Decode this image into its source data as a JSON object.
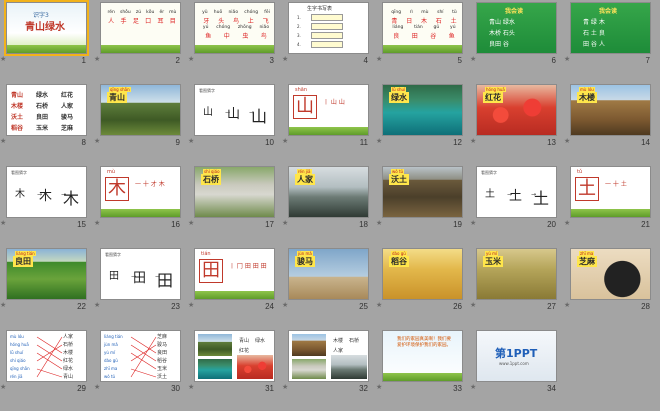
{
  "window": {
    "title": "Slide Sorter"
  },
  "slides": [
    {
      "n": "1",
      "kind": "title",
      "tag": "识字3",
      "title": "青山绿水",
      "foot": "第一PPT模板网-WWW.1PPT.COM"
    },
    {
      "n": "2",
      "kind": "pinyin",
      "rows": [
        [
          "rén",
          "shǒu",
          "zú",
          "kǒu",
          "ěr",
          "mù"
        ],
        [
          "人",
          "手",
          "足",
          "口",
          "耳",
          "目"
        ]
      ]
    },
    {
      "n": "3",
      "kind": "pinyin",
      "rows": [
        [
          "yǔ",
          "huō",
          "niǎo",
          "chóng",
          "fēi"
        ],
        [
          "牙",
          "头",
          "鸟",
          "上",
          "飞"
        ],
        [
          "yú",
          "chóng",
          "zhōng",
          "niǎo"
        ],
        [
          "鱼",
          "中",
          "虫",
          "鸟"
        ]
      ]
    },
    {
      "n": "4",
      "kind": "table",
      "title": "生字书写表",
      "rows": [
        "1.",
        "2.",
        "3.",
        "4."
      ]
    },
    {
      "n": "5",
      "kind": "pinyin",
      "rows": [
        [
          "qīng",
          "rì",
          "mù",
          "shí",
          "tǔ"
        ],
        [
          "青",
          "日",
          "木",
          "石",
          "土"
        ],
        [
          "liáng",
          "tián",
          "gǔ",
          "yú"
        ],
        [
          "良",
          "田",
          "谷",
          "鱼"
        ]
      ]
    },
    {
      "n": "6",
      "kind": "green",
      "head": "我会读",
      "lines": [
        "青山 绿水",
        "木桥 石头",
        "良田 谷"
      ]
    },
    {
      "n": "7",
      "kind": "green",
      "head": "我会读",
      "lines": [
        "青 绿 木",
        "石 土 良",
        "田 谷 人"
      ]
    },
    {
      "n": "8",
      "kind": "words",
      "cols": [
        "青山",
        "绿水",
        "红花"
      ],
      "rows": [
        [
          "青山",
          "绿水",
          "红花"
        ],
        [
          "木楼",
          "石桥",
          "人家"
        ],
        [
          "沃土",
          "良田",
          "骏马"
        ],
        [
          "稻谷",
          "玉米",
          "芝麻"
        ]
      ]
    },
    {
      "n": "9",
      "kind": "photo",
      "label": "青山",
      "pin": "qīng shān",
      "scene": "mountain"
    },
    {
      "n": "10",
      "kind": "evolve",
      "head": "看图猜字",
      "chars": [
        "山",
        "山",
        "山"
      ]
    },
    {
      "n": "11",
      "kind": "char",
      "pin": "shān",
      "char": "山",
      "stroke": "丨 山 山"
    },
    {
      "n": "12",
      "kind": "photo",
      "label": "绿水",
      "pin": "lǜ shuǐ",
      "scene": "lake"
    },
    {
      "n": "13",
      "kind": "photo",
      "label": "红花",
      "pin": "hóng huā",
      "scene": "flowers"
    },
    {
      "n": "14",
      "kind": "photo",
      "label": "木楼",
      "pin": "mù lóu",
      "scene": "house"
    },
    {
      "n": "15",
      "kind": "evolve",
      "head": "看图猜字",
      "chars": [
        "木",
        "木",
        "木"
      ]
    },
    {
      "n": "16",
      "kind": "char",
      "pin": "mù",
      "char": "木",
      "stroke": "一 十 才 木"
    },
    {
      "n": "17",
      "kind": "photo",
      "label": "石桥",
      "pin": "shí qiáo",
      "scene": "bridge"
    },
    {
      "n": "18",
      "kind": "photo",
      "label": "人家",
      "pin": "rén jiā",
      "scene": "village"
    },
    {
      "n": "19",
      "kind": "photo",
      "label": "沃土",
      "pin": "wò tǔ",
      "scene": "field"
    },
    {
      "n": "20",
      "kind": "evolve",
      "head": "看图猜字",
      "chars": [
        "土",
        "土",
        "土"
      ]
    },
    {
      "n": "21",
      "kind": "char",
      "pin": "tǔ",
      "char": "土",
      "stroke": "一 十 土"
    },
    {
      "n": "22",
      "kind": "photo",
      "label": "良田",
      "pin": "liáng tián",
      "scene": "farmland"
    },
    {
      "n": "23",
      "kind": "evolve",
      "head": "看图猜字",
      "chars": [
        "田",
        "田",
        "田"
      ]
    },
    {
      "n": "24",
      "kind": "char",
      "pin": "tián",
      "char": "田",
      "stroke": "丨 冂 田 田 田"
    },
    {
      "n": "25",
      "kind": "photo",
      "label": "骏马",
      "pin": "jùn mǎ",
      "scene": "horse"
    },
    {
      "n": "26",
      "kind": "photo",
      "label": "稻谷",
      "pin": "dào gǔ",
      "scene": "wheat"
    },
    {
      "n": "27",
      "kind": "photo",
      "label": "玉米",
      "pin": "yù mǐ",
      "scene": "corn"
    },
    {
      "n": "28",
      "kind": "photo",
      "label": "芝麻",
      "pin": "zhī ma",
      "scene": "sesame"
    },
    {
      "n": "29",
      "kind": "match",
      "left": [
        "mù lóu",
        "hóng huā",
        "lǜ shuǐ",
        "shí qiáo",
        "qīng shān",
        "rén jiā"
      ],
      "right": [
        "人家",
        "石桥",
        "木楼",
        "红花",
        "绿水",
        "青山"
      ]
    },
    {
      "n": "30",
      "kind": "match",
      "left": [
        "liáng tián",
        "jùn mǎ",
        "yù mǐ",
        "dào gǔ",
        "zhī ma",
        "wò tǔ"
      ],
      "right": [
        "芝麻",
        "骏马",
        "良田",
        "稻谷",
        "玉米",
        "沃土"
      ]
    },
    {
      "n": "31",
      "kind": "collage",
      "labels": [
        "青山",
        "绿水",
        "红花"
      ]
    },
    {
      "n": "32",
      "kind": "collage2",
      "labels": [
        "木楼",
        "石桥",
        "人家"
      ]
    },
    {
      "n": "33",
      "kind": "text",
      "text": "我们的家园真美啊！我们要爱护环境保护我们的家园。"
    },
    {
      "n": "34",
      "kind": "logo",
      "text": "第1PPT",
      "sub": "www.1ppt.com"
    }
  ]
}
